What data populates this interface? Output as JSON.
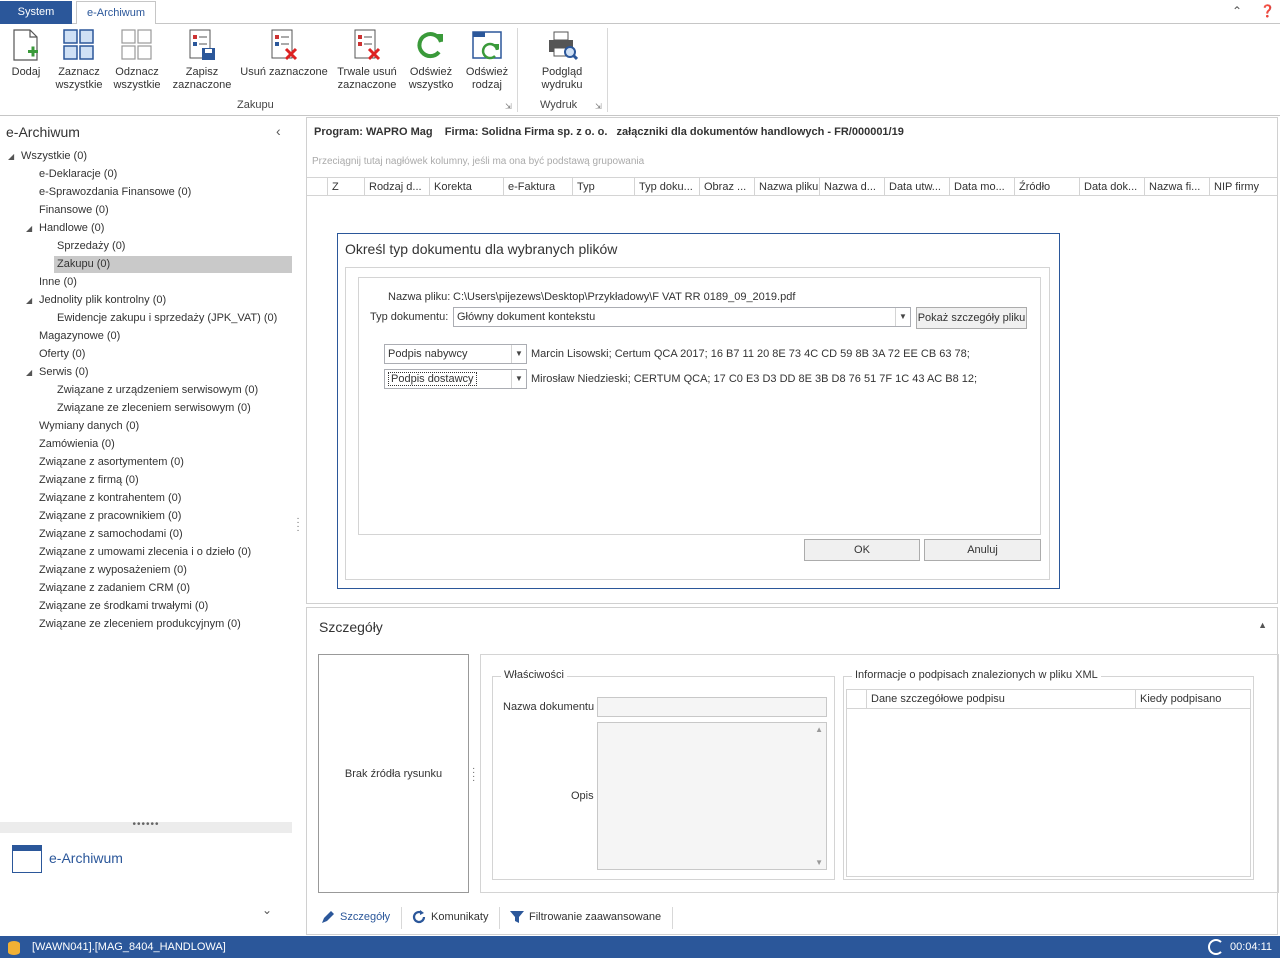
{
  "tabs": {
    "system": "System",
    "earchiwum": "e-Archiwum"
  },
  "ribbon": {
    "buttons": {
      "dodaj": "Dodaj",
      "zaznacz": "Zaznacz\nwszystkie",
      "odznacz": "Odznacz\nwszystkie",
      "zapisz": "Zapisz\nzaznaczone",
      "usun": "Usuń zaznaczone",
      "trwale": "Trwale usuń\nzaznaczone",
      "odswiez_wszystko": "Odśwież\nwszystko",
      "odswiez_rodzaj": "Odśwież\nrodzaj",
      "podglad": "Podgląd\nwydruku"
    },
    "groups": {
      "zakupu": "Zakupu",
      "wydruk": "Wydruk"
    }
  },
  "left_panel": {
    "title": "e-Archiwum",
    "tree": [
      {
        "label": "Wszystkie (0)",
        "level": 0,
        "expanded": true
      },
      {
        "label": "e-Deklaracje (0)",
        "level": 1
      },
      {
        "label": "e-Sprawozdania Finansowe (0)",
        "level": 1
      },
      {
        "label": "Finansowe (0)",
        "level": 1
      },
      {
        "label": "Handlowe (0)",
        "level": 1,
        "expanded": true
      },
      {
        "label": "Sprzedaży (0)",
        "level": 2
      },
      {
        "label": "Zakupu (0)",
        "level": 2,
        "selected": true
      },
      {
        "label": "Inne (0)",
        "level": 1
      },
      {
        "label": "Jednolity plik kontrolny (0)",
        "level": 1,
        "expanded": true
      },
      {
        "label": "Ewidencje zakupu i sprzedaży (JPK_VAT) (0)",
        "level": 2
      },
      {
        "label": "Magazynowe (0)",
        "level": 1
      },
      {
        "label": "Oferty (0)",
        "level": 1
      },
      {
        "label": "Serwis (0)",
        "level": 1,
        "expanded": true
      },
      {
        "label": "Związane z urządzeniem serwisowym (0)",
        "level": 2
      },
      {
        "label": "Związane ze zleceniem serwisowym (0)",
        "level": 2
      },
      {
        "label": "Wymiany danych (0)",
        "level": 1
      },
      {
        "label": "Zamówienia (0)",
        "level": 1
      },
      {
        "label": "Związane z asortymentem (0)",
        "level": 1
      },
      {
        "label": "Związane z firmą (0)",
        "level": 1
      },
      {
        "label": "Związane z kontrahentem (0)",
        "level": 1
      },
      {
        "label": "Związane z pracownikiem (0)",
        "level": 1
      },
      {
        "label": "Związane z samochodami (0)",
        "level": 1
      },
      {
        "label": "Związane z umowami zlecenia i o dzieło (0)",
        "level": 1
      },
      {
        "label": "Związane z wyposażeniem (0)",
        "level": 1
      },
      {
        "label": "Związane z zadaniem CRM (0)",
        "level": 1
      },
      {
        "label": "Związane ze środkami trwałymi (0)",
        "level": 1
      },
      {
        "label": "Związane ze zleceniem produkcyjnym (0)",
        "level": 1
      }
    ],
    "nav_label": "e-Archiwum"
  },
  "grid": {
    "program_header": "Program: WAPRO Mag    Firma: Solidna Firma sp. z o. o.   załączniki dla dokumentów handlowych - FR/000001/19",
    "group_hint": "Przeciągnij tutaj nagłówek kolumny, jeśli ma ona być podstawą grupowania",
    "columns": [
      "Z",
      "Rodzaj d...",
      "Korekta",
      "e-Faktura",
      "Typ",
      "Typ doku...",
      "Obraz ...",
      "Nazwa pliku",
      "Nazwa d...",
      "Data utw...",
      "Data mo...",
      "Źródło",
      "Data dok...",
      "Nazwa fi...",
      "NIP firmy"
    ]
  },
  "dialog": {
    "title": "Określ typ dokumentu dla wybranych plików",
    "file_label": "Nazwa pliku:",
    "file_value": "C:\\Users\\pijezews\\Desktop\\Przykładowy\\F VAT RR 0189_09_2019.pdf",
    "type_label": "Typ dokumentu:",
    "type_value": "Główny dokument kontekstu",
    "show_details": "Pokaż szczegóły pliku",
    "signatures": [
      {
        "role": "Podpis nabywcy",
        "info": "Marcin Lisowski; Certum QCA 2017; 16 B7 11 20 8E 73 4C CD 59 8B 3A 72 EE CB 63 78;"
      },
      {
        "role": "Podpis dostawcy",
        "info": "Mirosław Niedzieski; CERTUM QCA; 17 C0 E3 D3 DD 8E 3B D8 76 51 7F 1C 43 AC B8 12;"
      }
    ],
    "ok": "OK",
    "cancel": "Anuluj"
  },
  "details": {
    "title": "Szczegóły",
    "no_image": "Brak źródła rysunku",
    "properties_legend": "Właściwości",
    "doc_name_label": "Nazwa dokumentu",
    "doc_name_value": "",
    "opis_label": "Opis",
    "opis_value": "",
    "sig_legend": "Informacje o podpisach znalezionych w pliku XML",
    "sig_columns": [
      "Dane szczegółowe podpisu",
      "Kiedy podpisano"
    ]
  },
  "bottom_tabs": {
    "szczegoly": "Szczegóły",
    "komunikaty": "Komunikaty",
    "filtrowanie": "Filtrowanie zaawansowane"
  },
  "status": {
    "db": "[WAWN041].[MAG_8404_HANDLOWA]",
    "time": "00:04:11"
  },
  "colors": {
    "accent": "#2b579a",
    "selected": "#c9c9c9"
  }
}
